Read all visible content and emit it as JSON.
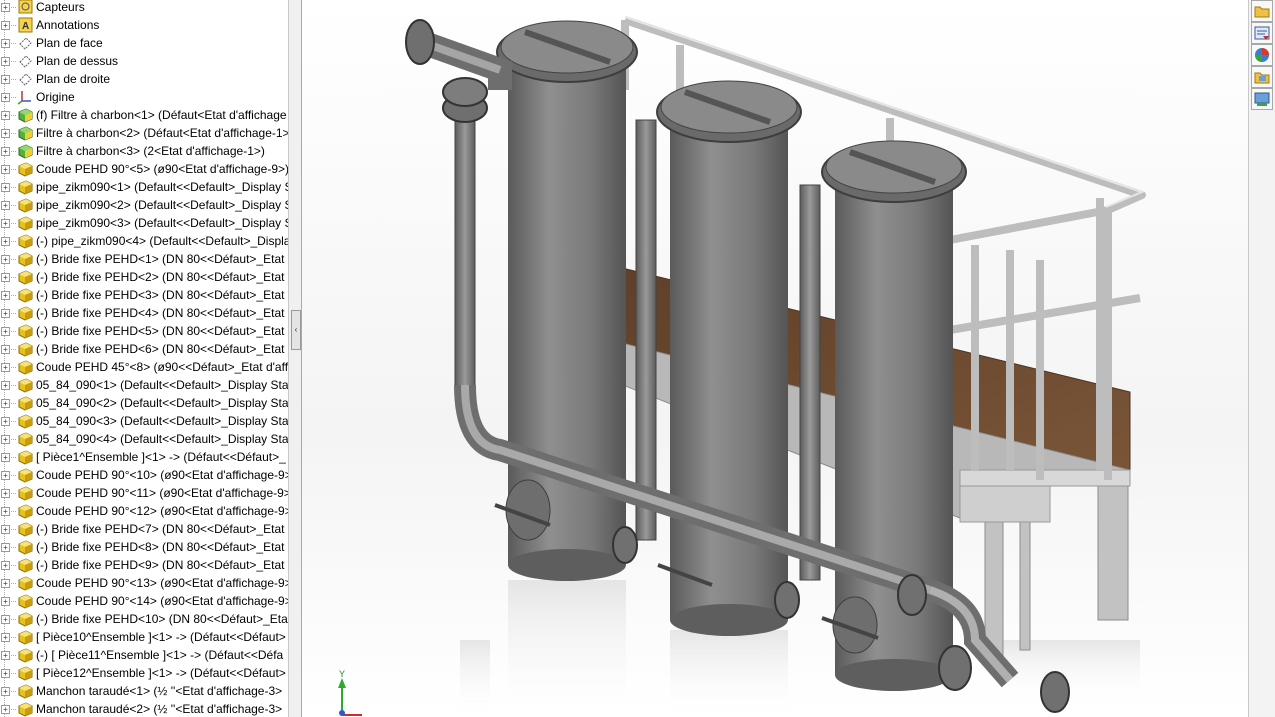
{
  "feature_tree": {
    "items": [
      {
        "label": "Capteurs",
        "icon": "sensor-icon"
      },
      {
        "label": "Annotations",
        "icon": "annotation-icon"
      },
      {
        "label": "Plan de face",
        "icon": "plane-icon"
      },
      {
        "label": "Plan de dessus",
        "icon": "plane-icon"
      },
      {
        "label": "Plan de droite",
        "icon": "plane-icon"
      },
      {
        "label": "Origine",
        "icon": "origin-icon"
      },
      {
        "label": "(f) Filtre à charbon<1> (Défaut<Etat d'affichage",
        "icon": "assembly-icon"
      },
      {
        "label": "Filtre à charbon<2> (Défaut<Etat d'affichage-1>",
        "icon": "assembly-icon"
      },
      {
        "label": "Filtre à charbon<3> (2<Etat d'affichage-1>)",
        "icon": "assembly-icon"
      },
      {
        "label": "Coude PEHD 90°<5> (ø90<Etat d'affichage-9>)",
        "icon": "part-icon"
      },
      {
        "label": "pipe_zikm090<1> (Default<<Default>_Display S",
        "icon": "part-icon"
      },
      {
        "label": "pipe_zikm090<2> (Default<<Default>_Display S",
        "icon": "part-icon"
      },
      {
        "label": "pipe_zikm090<3> (Default<<Default>_Display S",
        "icon": "part-icon"
      },
      {
        "label": "(-) pipe_zikm090<4> (Default<<Default>_Displa",
        "icon": "part-icon"
      },
      {
        "label": "(-) Bride fixe PEHD<1> (DN 80<<Défaut>_Etat d",
        "icon": "part-icon"
      },
      {
        "label": "(-) Bride fixe PEHD<2> (DN 80<<Défaut>_Etat d",
        "icon": "part-icon"
      },
      {
        "label": "(-) Bride fixe PEHD<3> (DN 80<<Défaut>_Etat d",
        "icon": "part-icon"
      },
      {
        "label": "(-) Bride fixe PEHD<4> (DN 80<<Défaut>_Etat d",
        "icon": "part-icon"
      },
      {
        "label": "(-) Bride fixe PEHD<5> (DN 80<<Défaut>_Etat d",
        "icon": "part-icon"
      },
      {
        "label": "(-) Bride fixe PEHD<6> (DN 80<<Défaut>_Etat d",
        "icon": "part-icon"
      },
      {
        "label": "Coude PEHD 45°<8> (ø90<<Défaut>_Etat d'affi",
        "icon": "part-icon"
      },
      {
        "label": "05_84_090<1> (Default<<Default>_Display State",
        "icon": "part-icon"
      },
      {
        "label": "05_84_090<2> (Default<<Default>_Display State",
        "icon": "part-icon"
      },
      {
        "label": "05_84_090<3> (Default<<Default>_Display State",
        "icon": "part-icon"
      },
      {
        "label": "05_84_090<4> (Default<<Default>_Display State",
        "icon": "part-icon"
      },
      {
        "label": "[ Pièce1^Ensemble ]<1> -> (Défaut<<Défaut>_",
        "icon": "part-icon"
      },
      {
        "label": "Coude PEHD 90°<10> (ø90<Etat d'affichage-9>",
        "icon": "part-icon"
      },
      {
        "label": "Coude PEHD 90°<11> (ø90<Etat d'affichage-9>",
        "icon": "part-icon"
      },
      {
        "label": "Coude PEHD 90°<12> (ø90<Etat d'affichage-9>",
        "icon": "part-icon"
      },
      {
        "label": "(-) Bride fixe PEHD<7> (DN 80<<Défaut>_Etat d",
        "icon": "part-icon"
      },
      {
        "label": "(-) Bride fixe PEHD<8> (DN 80<<Défaut>_Etat d",
        "icon": "part-icon"
      },
      {
        "label": "(-) Bride fixe PEHD<9> (DN 80<<Défaut>_Etat d",
        "icon": "part-icon"
      },
      {
        "label": "Coude PEHD 90°<13> (ø90<Etat d'affichage-9>",
        "icon": "part-icon"
      },
      {
        "label": "Coude PEHD 90°<14> (ø90<Etat d'affichage-9>",
        "icon": "part-icon"
      },
      {
        "label": "(-) Bride fixe PEHD<10> (DN 80<<Défaut>_Etat",
        "icon": "part-icon"
      },
      {
        "label": "[ Pièce10^Ensemble ]<1> -> (Défaut<<Défaut>",
        "icon": "part-icon"
      },
      {
        "label": "(-) [ Pièce11^Ensemble ]<1> -> (Défaut<<Défa",
        "icon": "part-icon"
      },
      {
        "label": "[ Pièce12^Ensemble ]<1> -> (Défaut<<Défaut>",
        "icon": "part-icon"
      },
      {
        "label": "Manchon taraudé<1> (½ ''<Etat d'affichage-3>",
        "icon": "part-icon"
      },
      {
        "label": "Manchon taraudé<2> (½ ''<Etat d'affichage-3>",
        "icon": "part-icon"
      }
    ]
  },
  "splitter": {
    "handle_glyph": "‹"
  },
  "viewport": {
    "triad_label": "Y"
  },
  "task_pane": {
    "buttons": [
      {
        "name": "resources-button",
        "icon": "folder-icon"
      },
      {
        "name": "design-library-button",
        "icon": "library-icon"
      },
      {
        "name": "appearances-button",
        "icon": "appearances-icon"
      },
      {
        "name": "file-explorer-button",
        "icon": "explorer-icon"
      },
      {
        "name": "custom-properties-button",
        "icon": "properties-icon"
      }
    ]
  },
  "colors": {
    "tank_gray": "#7d7d7d",
    "deck_brown": "#6b4a30",
    "rail_gray": "#b9b9b9",
    "tree_assembly_green": "#3f9b2e",
    "tree_part_yellow": "#e8c21c"
  }
}
